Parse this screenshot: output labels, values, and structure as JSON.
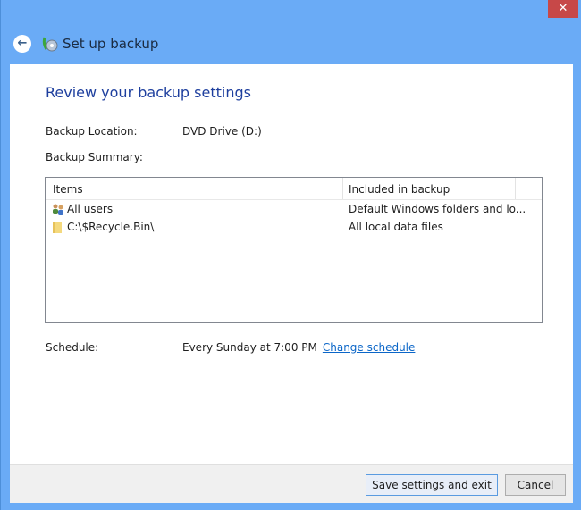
{
  "window": {
    "title": "Set up backup",
    "close_label": "✕"
  },
  "heading": "Review your backup settings",
  "location": {
    "label": "Backup Location:",
    "value": "DVD Drive (D:)"
  },
  "summary": {
    "label": "Backup Summary:",
    "columns": [
      "Items",
      "Included in backup"
    ],
    "rows": [
      {
        "item": "All users",
        "included": "Default Windows folders and lo...",
        "icon": "users-icon"
      },
      {
        "item": "C:\\$Recycle.Bin\\",
        "included": "All local data files",
        "icon": "folder-icon"
      }
    ]
  },
  "schedule": {
    "label": "Schedule:",
    "value": "Every Sunday at 7:00 PM",
    "link": "Change schedule"
  },
  "buttons": {
    "save": "Save settings and exit",
    "cancel": "Cancel"
  }
}
